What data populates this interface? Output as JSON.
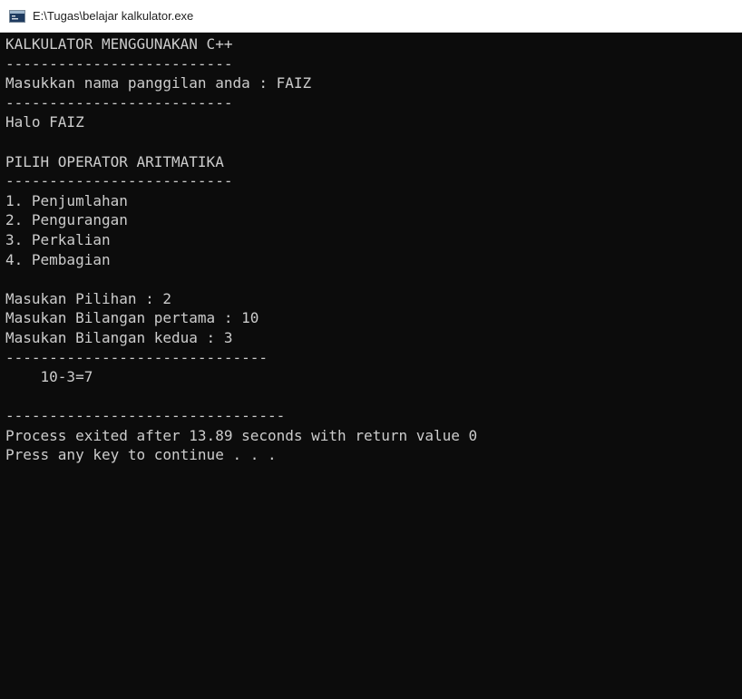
{
  "window": {
    "title": "E:\\Tugas\\belajar kalkulator.exe",
    "icon": "console-app-icon"
  },
  "console": {
    "lines": [
      "KALKULATOR MENGGUNAKAN C++",
      "--------------------------",
      "Masukkan nama panggilan anda : FAIZ",
      "--------------------------",
      "Halo FAIZ",
      "",
      "PILIH OPERATOR ARITMATIKA",
      "--------------------------",
      "1. Penjumlahan",
      "2. Pengurangan",
      "3. Perkalian",
      "4. Pembagian",
      "",
      "Masukan Pilihan : 2",
      "Masukan Bilangan pertama : 10",
      "Masukan Bilangan kedua : 3",
      "------------------------------",
      "    10-3=7",
      "",
      "--------------------------------",
      "Process exited after 13.89 seconds with return value 0",
      "Press any key to continue . . ."
    ]
  },
  "colors": {
    "console_bg": "#0c0c0c",
    "console_fg": "#cccccc",
    "titlebar_bg": "#ffffff"
  }
}
